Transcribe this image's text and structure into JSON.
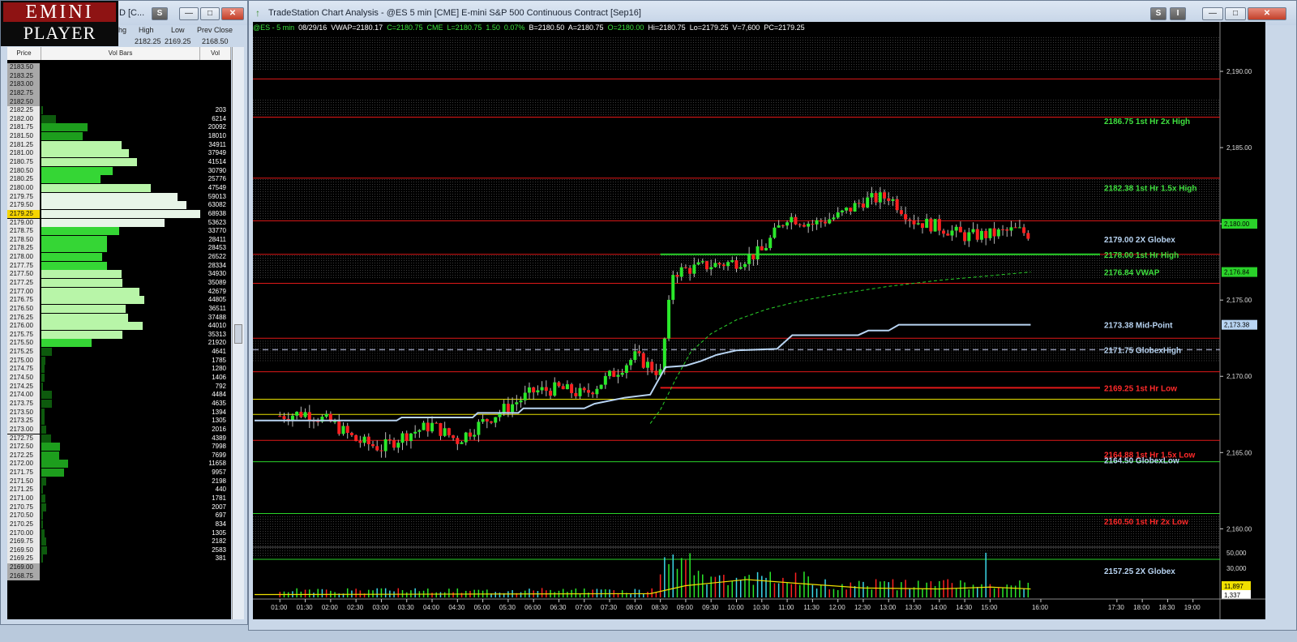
{
  "logo": {
    "line1": "EMINI",
    "line2": "PLAYER"
  },
  "left_window": {
    "title_fragment": "D [C...",
    "drop_label": "S",
    "headers": [
      "hg",
      "High",
      "Low",
      "Prev Close"
    ],
    "values": [
      "2182.25",
      "2169.25",
      "2168.50"
    ],
    "ladder_headers": {
      "price": "Price",
      "bars": "Vol Bars",
      "vol": "Vol"
    }
  },
  "ladder_rows": [
    {
      "price": "2183.50",
      "vol": ""
    },
    {
      "price": "2183.25",
      "vol": ""
    },
    {
      "price": "2183.00",
      "vol": ""
    },
    {
      "price": "2182.75",
      "vol": ""
    },
    {
      "price": "2182.50",
      "vol": ""
    },
    {
      "price": "2182.25",
      "vol": "203"
    },
    {
      "price": "2182.00",
      "vol": "6214"
    },
    {
      "price": "2181.75",
      "vol": "20092"
    },
    {
      "price": "2181.50",
      "vol": "18010"
    },
    {
      "price": "2181.25",
      "vol": "34911"
    },
    {
      "price": "2181.00",
      "vol": "37949"
    },
    {
      "price": "2180.75",
      "vol": "41514"
    },
    {
      "price": "2180.50",
      "vol": "30790"
    },
    {
      "price": "2180.25",
      "vol": "25776"
    },
    {
      "price": "2180.00",
      "vol": "47549"
    },
    {
      "price": "2179.75",
      "vol": "59013"
    },
    {
      "price": "2179.50",
      "vol": "63082"
    },
    {
      "price": "2179.25",
      "vol": "68938"
    },
    {
      "price": "2179.00",
      "vol": "53623"
    },
    {
      "price": "2178.75",
      "vol": "33770"
    },
    {
      "price": "2178.50",
      "vol": "28411"
    },
    {
      "price": "2178.25",
      "vol": "28453"
    },
    {
      "price": "2178.00",
      "vol": "26522"
    },
    {
      "price": "2177.75",
      "vol": "28334"
    },
    {
      "price": "2177.50",
      "vol": "34930"
    },
    {
      "price": "2177.25",
      "vol": "35089"
    },
    {
      "price": "2177.00",
      "vol": "42679"
    },
    {
      "price": "2176.75",
      "vol": "44805"
    },
    {
      "price": "2176.50",
      "vol": "36511"
    },
    {
      "price": "2176.25",
      "vol": "37488"
    },
    {
      "price": "2176.00",
      "vol": "44010"
    },
    {
      "price": "2175.75",
      "vol": "35313"
    },
    {
      "price": "2175.50",
      "vol": "21920"
    },
    {
      "price": "2175.25",
      "vol": "4641"
    },
    {
      "price": "2175.00",
      "vol": "1785"
    },
    {
      "price": "2174.75",
      "vol": "1280"
    },
    {
      "price": "2174.50",
      "vol": "1406"
    },
    {
      "price": "2174.25",
      "vol": "792"
    },
    {
      "price": "2174.00",
      "vol": "4484"
    },
    {
      "price": "2173.75",
      "vol": "4635"
    },
    {
      "price": "2173.50",
      "vol": "1394"
    },
    {
      "price": "2173.25",
      "vol": "1305"
    },
    {
      "price": "2173.00",
      "vol": "2016"
    },
    {
      "price": "2172.75",
      "vol": "4389"
    },
    {
      "price": "2172.50",
      "vol": "7998"
    },
    {
      "price": "2172.25",
      "vol": "7699"
    },
    {
      "price": "2172.00",
      "vol": "11658"
    },
    {
      "price": "2171.75",
      "vol": "9957"
    },
    {
      "price": "2171.50",
      "vol": "2198"
    },
    {
      "price": "2171.25",
      "vol": "440"
    },
    {
      "price": "2171.00",
      "vol": "1781"
    },
    {
      "price": "2170.75",
      "vol": "2007"
    },
    {
      "price": "2170.50",
      "vol": "697"
    },
    {
      "price": "2170.25",
      "vol": "834"
    },
    {
      "price": "2170.00",
      "vol": "1305"
    },
    {
      "price": "2169.75",
      "vol": "2182"
    },
    {
      "price": "2169.50",
      "vol": "2583"
    },
    {
      "price": "2169.25",
      "vol": "381"
    },
    {
      "price": "2169.00",
      "vol": ""
    },
    {
      "price": "2168.75",
      "vol": ""
    }
  ],
  "current_price": "2179.25",
  "chart_window": {
    "title": "TradeStation Chart Analysis - @ES 5 min [CME] E-mini S&P 500 Continuous Contract [Sep16]",
    "btn_s": "S",
    "btn_i": "I"
  },
  "infobar": {
    "symbol": "@ES - 5 min",
    "date": "08/29/16",
    "vwap": "VWAP=2180.17",
    "close": "C=2180.75",
    "exchange": "CME",
    "last": "L=2180.75",
    "change": "1.50",
    "pct": "0.07%",
    "bid": "B=2180.50",
    "ask": "A=2180.75",
    "open": "O=2180.00",
    "hi": "Hi=2180.75",
    "lo": "Lo=2179.25",
    "vol": "V=7,600",
    "pc": "PC=2179.25"
  },
  "levels": [
    {
      "price": 2186.75,
      "label": "2186.75 1st Hr  2x High",
      "color": "#3fe03f"
    },
    {
      "price": 2182.38,
      "label": "2182.38 1st Hr  1.5x High",
      "color": "#3fe03f"
    },
    {
      "price": 2179.0,
      "label": "2179.00 2X Globex",
      "color": "#b8d4f2"
    },
    {
      "price": 2178.0,
      "label": "2178.00 1st Hr  High",
      "color": "#3fe03f"
    },
    {
      "price": 2176.84,
      "label": "2176.84 VWAP",
      "color": "#3fe03f"
    },
    {
      "price": 2173.38,
      "label": "2173.38 Mid-Point",
      "color": "#b8d4f2"
    },
    {
      "price": 2171.75,
      "label": "2171.75 GlobexHigh",
      "color": "#b8d4f2"
    },
    {
      "price": 2169.25,
      "label": "2169.25 1st Hr  Low",
      "color": "#ff2a2a"
    },
    {
      "price": 2164.88,
      "label": "2164.88 1st Hr  1.5x Low",
      "color": "#ff2a2a"
    },
    {
      "price": 2164.5,
      "label": "2164.50 GlobexLow",
      "color": "#b8d4f2"
    },
    {
      "price": 2160.5,
      "label": "2160.50 1st Hr  2x Low",
      "color": "#ff2a2a"
    },
    {
      "price": 2157.25,
      "label": "2157.25 2X Globex",
      "color": "#b8d4f2"
    }
  ],
  "chart_data": {
    "type": "candlestick",
    "x_tick_labels": [
      "01:00",
      "01:30",
      "02:00",
      "02:30",
      "03:00",
      "03:30",
      "04:00",
      "04:30",
      "05:00",
      "05:30",
      "06:00",
      "06:30",
      "07:00",
      "07:30",
      "08:00",
      "08:30",
      "09:00",
      "09:30",
      "10:00",
      "10:30",
      "11:00",
      "11:30",
      "12:00",
      "12:30",
      "13:00",
      "13:30",
      "14:00",
      "14:30",
      "15:00",
      "16:00",
      "17:30",
      "18:00",
      "18:30",
      "19:00"
    ],
    "y_tick_labels": [
      "2,190.00",
      "2,185.00",
      "2,180.00",
      "2,175.00",
      "2,170.00",
      "2,165.00",
      "2,160.00"
    ],
    "y_ticks": [
      2190,
      2185,
      2180,
      2175,
      2170,
      2165,
      2160
    ],
    "ylim": [
      2155.5,
      2192.5
    ],
    "price_tags": [
      "2,180.00",
      "2,176.84",
      "2,173.38"
    ],
    "volume_tick_labels": [
      "50,000",
      "30,000",
      "10,000"
    ],
    "volume_tags": [
      "11,897",
      "1,337"
    ],
    "price_path": [
      [
        "01:00",
        2167.4
      ],
      [
        "01:30",
        2167.6
      ],
      [
        "02:00",
        2167.0
      ],
      [
        "02:30",
        2165.8
      ],
      [
        "03:00",
        2165.3
      ],
      [
        "03:30",
        2166.2
      ],
      [
        "04:00",
        2166.8
      ],
      [
        "04:30",
        2165.8
      ],
      [
        "05:00",
        2167.0
      ],
      [
        "05:30",
        2168.0
      ],
      [
        "06:00",
        2169.0
      ],
      [
        "06:30",
        2169.2
      ],
      [
        "07:00",
        2168.8
      ],
      [
        "07:30",
        2170.0
      ],
      [
        "08:00",
        2171.3
      ],
      [
        "08:30",
        2170.2
      ],
      [
        "08:45",
        2176.8
      ],
      [
        "09:00",
        2177.0
      ],
      [
        "09:30",
        2177.3
      ],
      [
        "10:00",
        2177.5
      ],
      [
        "10:30",
        2178.2
      ],
      [
        "11:00",
        2180.5
      ],
      [
        "11:30",
        2180.0
      ],
      [
        "12:00",
        2180.5
      ],
      [
        "12:30",
        2181.5
      ],
      [
        "13:00",
        2181.8
      ],
      [
        "13:30",
        2180.2
      ],
      [
        "14:00",
        2179.8
      ],
      [
        "14:30",
        2179.2
      ],
      [
        "15:00",
        2179.3
      ],
      [
        "15:30",
        2179.6
      ],
      [
        "15:50",
        2179.25
      ]
    ]
  }
}
